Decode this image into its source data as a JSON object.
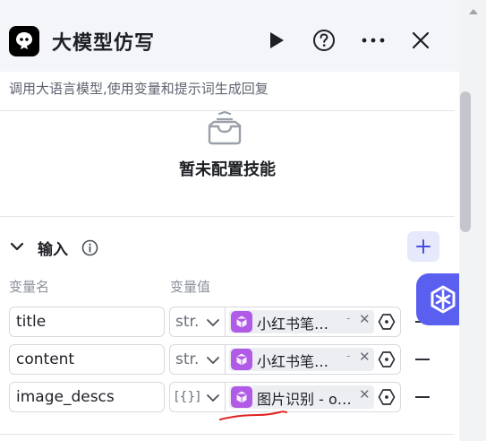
{
  "header": {
    "title": "大模型仿写",
    "description": "调用大语言模型,使用变量和提示词生成回复"
  },
  "skills": {
    "empty_text": "暂未配置技能"
  },
  "input_section": {
    "title": "输入",
    "col_name": "变量名",
    "col_value": "变量值",
    "rows": [
      {
        "name": "title",
        "type": "str.",
        "value": "小红书笔…",
        "value_sep": "-"
      },
      {
        "name": "content",
        "type": "str.",
        "value": "小红书笔…",
        "value_sep": "-"
      },
      {
        "name": "image_descs",
        "type": "[{}]",
        "value": "图片识别 - o…",
        "value_sep": ""
      }
    ]
  },
  "colors": {
    "accent": "#5b5ff0",
    "node_purple": "#b15ae6",
    "annotation_red": "#e02020"
  }
}
